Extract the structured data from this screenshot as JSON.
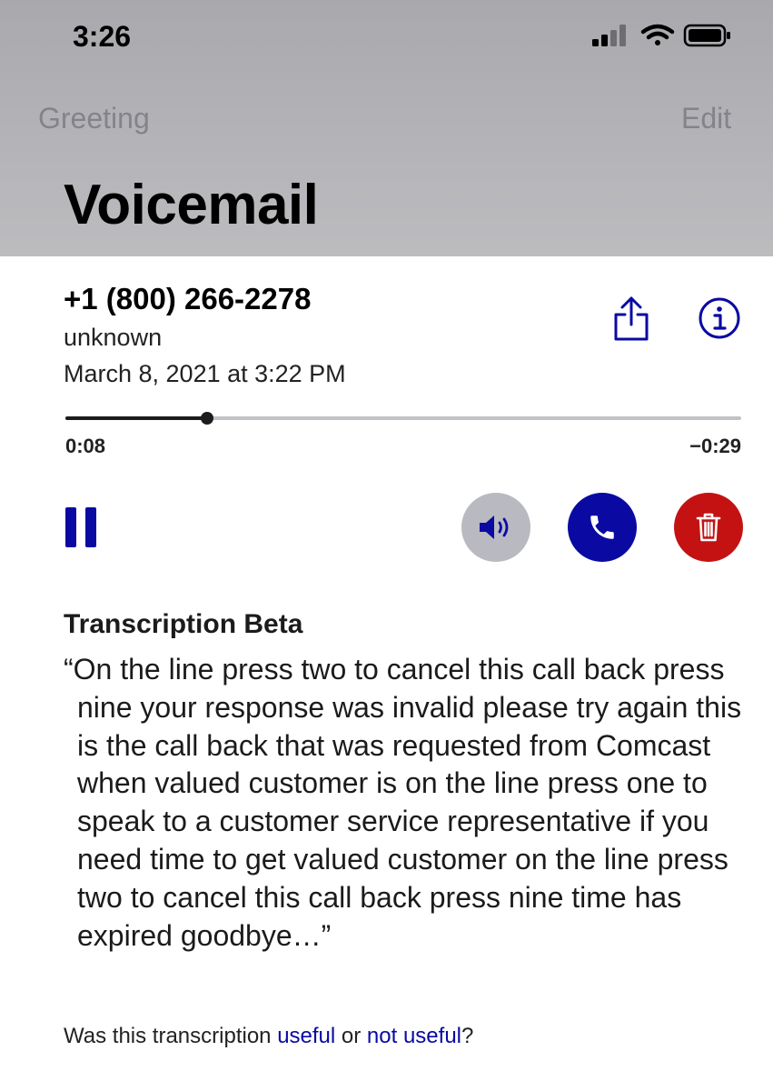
{
  "status_bar": {
    "time": "3:26",
    "icons": [
      "cellular-signal-icon",
      "wifi-icon",
      "battery-icon"
    ]
  },
  "nav": {
    "left_label": "Greeting",
    "right_label": "Edit",
    "title": "Voicemail"
  },
  "voicemail": {
    "caller_number": "+1 (800) 266-2278",
    "caller_label": "unknown",
    "date": "March 8, 2021 at 3:22 PM",
    "elapsed": "0:08",
    "remaining": "−0:29",
    "progress_fraction": 0.21
  },
  "controls": {
    "icons": [
      "pause-icon",
      "speaker-icon",
      "phone-icon",
      "trash-icon",
      "share-icon",
      "info-icon"
    ]
  },
  "transcription": {
    "heading": "Transcription Beta",
    "text": "“On the line press two to cancel this call back press nine your response was invalid please try again this is the call back that was requested from Comcast when valued customer is on the line press one to speak to a customer service representative if you need time to get valued customer on the line press two to cancel this call back press nine time has expired goodbye…”",
    "feedback_prefix": "Was this transcription ",
    "feedback_useful": "useful",
    "feedback_middle": " or ",
    "feedback_not_useful": "not useful",
    "feedback_suffix": "?"
  },
  "colors": {
    "accent": "#0a0aa3",
    "delete": "#c41212",
    "speaker_bg": "#b9b9c1",
    "header_bg": "#b0b0b4"
  }
}
